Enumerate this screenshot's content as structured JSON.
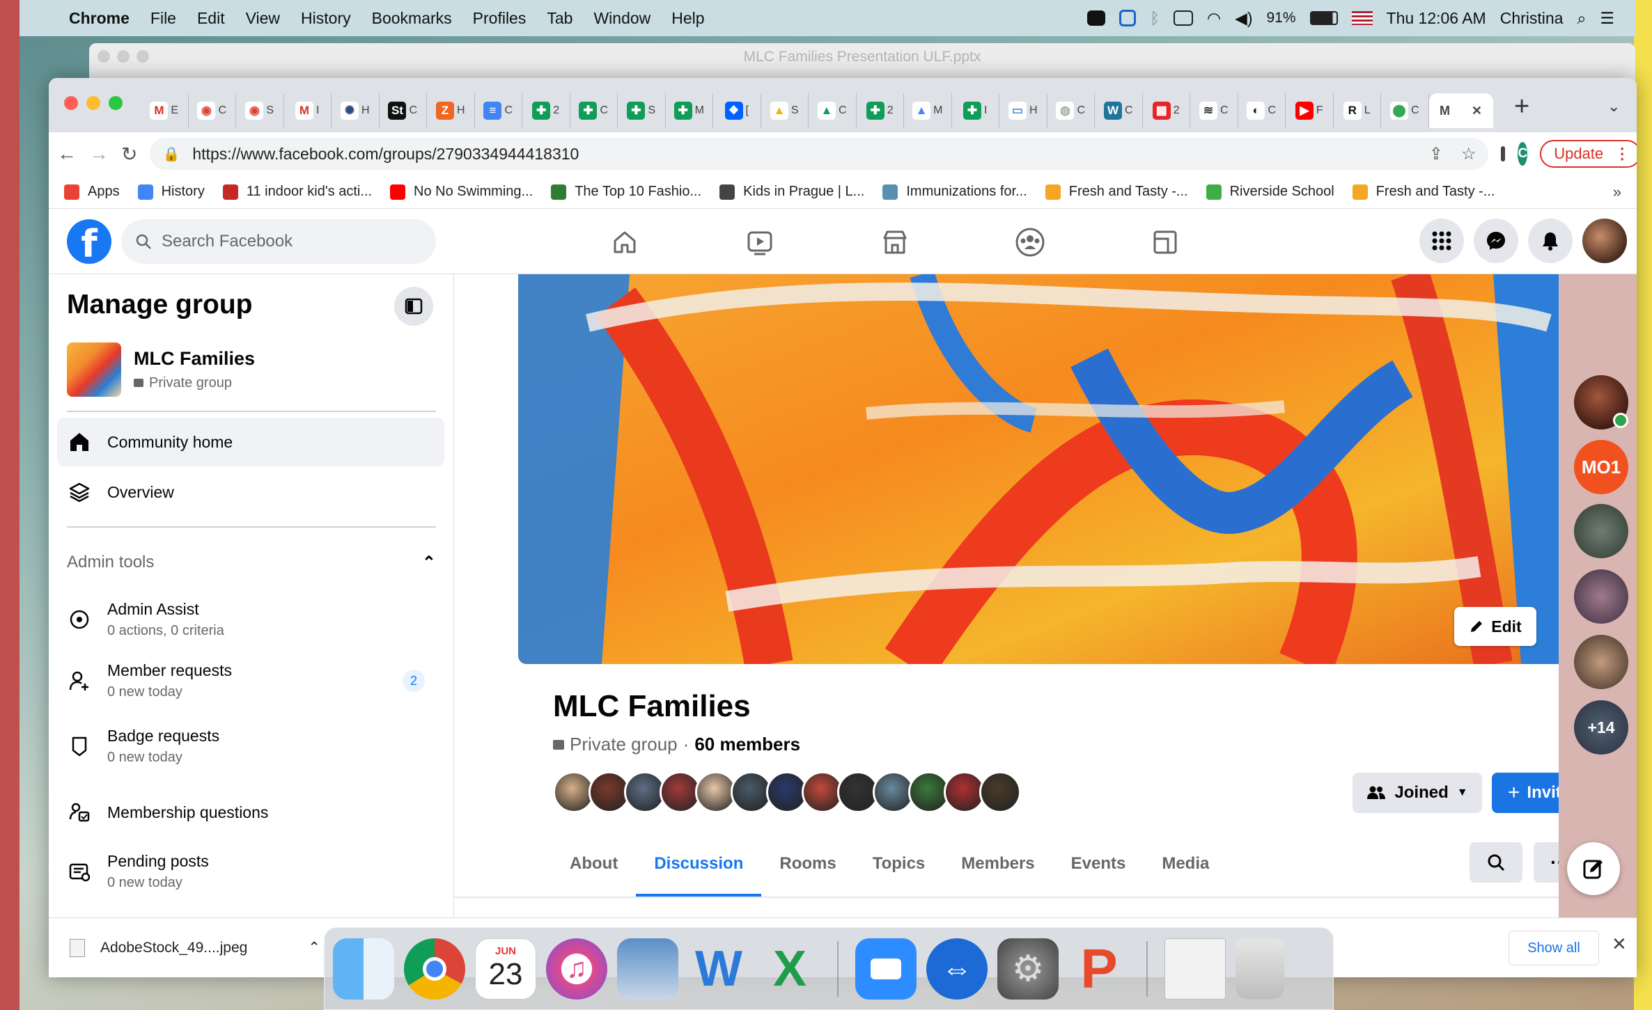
{
  "menubar": {
    "app": "Chrome",
    "items": [
      "File",
      "Edit",
      "View",
      "History",
      "Bookmarks",
      "Profiles",
      "Tab",
      "Window",
      "Help"
    ],
    "battery": "91%",
    "clock": "Thu 12:06 AM",
    "user": "Christina"
  },
  "bg_window": {
    "title": "MLC Families Presentation ULF.pptx"
  },
  "chrome": {
    "tabs": [
      {
        "fav": "M",
        "ch": "E",
        "color": "#ffffff",
        "fg": "#d93025"
      },
      {
        "fav": "◉",
        "ch": "C",
        "color": "#ffffff",
        "fg": "#db4437"
      },
      {
        "fav": "◉",
        "ch": "S",
        "color": "#ffffff",
        "fg": "#db4437"
      },
      {
        "fav": "M",
        "ch": "I",
        "color": "#ffffff",
        "fg": "#d93025"
      },
      {
        "fav": "✺",
        "ch": "H",
        "color": "#ffffff",
        "fg": "#2b4c7e"
      },
      {
        "fav": "St",
        "ch": "C",
        "color": "#111111",
        "fg": "#ffffff"
      },
      {
        "fav": "Z",
        "ch": "H",
        "color": "#f26522",
        "fg": "#ffffff"
      },
      {
        "fav": "≡",
        "ch": "C",
        "color": "#4285f4",
        "fg": "#ffffff"
      },
      {
        "fav": "✚",
        "ch": "2",
        "color": "#0f9d58",
        "fg": "#ffffff"
      },
      {
        "fav": "✚",
        "ch": "C",
        "color": "#0f9d58",
        "fg": "#ffffff"
      },
      {
        "fav": "✚",
        "ch": "S",
        "color": "#0f9d58",
        "fg": "#ffffff"
      },
      {
        "fav": "✚",
        "ch": "M",
        "color": "#0f9d58",
        "fg": "#ffffff"
      },
      {
        "fav": "❖",
        "ch": "[",
        "color": "#0061fe",
        "fg": "#ffffff"
      },
      {
        "fav": "▲",
        "ch": "S",
        "color": "#ffffff",
        "fg": "#f4b400"
      },
      {
        "fav": "▲",
        "ch": "C",
        "color": "#ffffff",
        "fg": "#0f9d58"
      },
      {
        "fav": "✚",
        "ch": "2",
        "color": "#0f9d58",
        "fg": "#ffffff"
      },
      {
        "fav": "▲",
        "ch": "M",
        "color": "#ffffff",
        "fg": "#4285f4"
      },
      {
        "fav": "✚",
        "ch": "I",
        "color": "#0f9d58",
        "fg": "#ffffff"
      },
      {
        "fav": "▭",
        "ch": "H",
        "color": "#ffffff",
        "fg": "#4a8fd8"
      },
      {
        "fav": "◍",
        "ch": "C",
        "color": "#ffffff",
        "fg": "#9bb09b"
      },
      {
        "fav": "W",
        "ch": "C",
        "color": "#21759b",
        "fg": "#ffffff"
      },
      {
        "fav": "▦",
        "ch": "2",
        "color": "#e5252a",
        "fg": "#ffffff"
      },
      {
        "fav": "≋",
        "ch": "C",
        "color": "#ffffff",
        "fg": "#333333"
      },
      {
        "fav": "◐",
        "ch": "C",
        "color": "#ffffff",
        "fg": "#222222"
      },
      {
        "fav": "▶",
        "ch": "F",
        "color": "#ff0000",
        "fg": "#ffffff"
      },
      {
        "fav": "R",
        "ch": "L",
        "color": "#ffffff",
        "fg": "#111111"
      },
      {
        "fav": "⬤",
        "ch": "C",
        "color": "#ffffff",
        "fg": "#34a853"
      }
    ],
    "active_tab_char": "M",
    "url": "https://www.facebook.com/groups/2790334944418310",
    "profile_initial": "C",
    "update_label": "Update",
    "bookmarks": [
      {
        "label": "Apps",
        "color": "#ea4335"
      },
      {
        "label": "History",
        "color": "#4285f4"
      },
      {
        "label": "11 indoor kid's acti...",
        "color": "#c62828"
      },
      {
        "label": "No No Swimming...",
        "color": "#ff0000"
      },
      {
        "label": "The Top 10 Fashio...",
        "color": "#2e7d32"
      },
      {
        "label": "Kids in Prague | L...",
        "color": "#444444"
      },
      {
        "label": "Immunizations for...",
        "color": "#5a8fb0"
      },
      {
        "label": "Fresh and Tasty -...",
        "color": "#f5a623"
      },
      {
        "label": "Riverside School",
        "color": "#3fae49"
      },
      {
        "label": "Fresh and Tasty -...",
        "color": "#f5a623"
      }
    ]
  },
  "facebook": {
    "search_placeholder": "Search Facebook",
    "sidebar": {
      "title": "Manage group",
      "group_name": "MLC Families",
      "group_privacy": "Private group",
      "community_home": "Community home",
      "overview": "Overview",
      "admin_tools": "Admin tools",
      "items": [
        {
          "label": "Admin Assist",
          "sub": "0 actions, 0 criteria"
        },
        {
          "label": "Member requests",
          "sub": "0 new today",
          "badge": "2"
        },
        {
          "label": "Badge requests",
          "sub": "0 new today"
        },
        {
          "label": "Membership questions",
          "sub": ""
        },
        {
          "label": "Pending posts",
          "sub": "0 new today"
        }
      ]
    },
    "group": {
      "title": "MLC Families",
      "privacy": "Private group",
      "separator": "·",
      "members": "60 members",
      "edit_label": "Edit",
      "joined_label": "Joined",
      "invite_label": "Invite",
      "tabs": [
        "About",
        "Discussion",
        "Rooms",
        "Topics",
        "Members",
        "Events",
        "Media"
      ],
      "active_tab": "Discussion",
      "facepile_colors": [
        "#d8b08a",
        "#7a3a2a",
        "#5d6e86",
        "#a33a3a",
        "#e8c6a8",
        "#4a5a66",
        "#2a3a6a",
        "#c24a3a",
        "#333333",
        "#6a8aa0",
        "#3a7a3a",
        "#b03030",
        "#4a3a2a"
      ]
    },
    "contacts": {
      "m01": "MO1",
      "more": "+14"
    }
  },
  "downloads": {
    "file": "AdobeStock_49....jpeg",
    "show_all": "Show all"
  },
  "dock": {
    "calendar_month": "JUN",
    "calendar_day": "23"
  }
}
